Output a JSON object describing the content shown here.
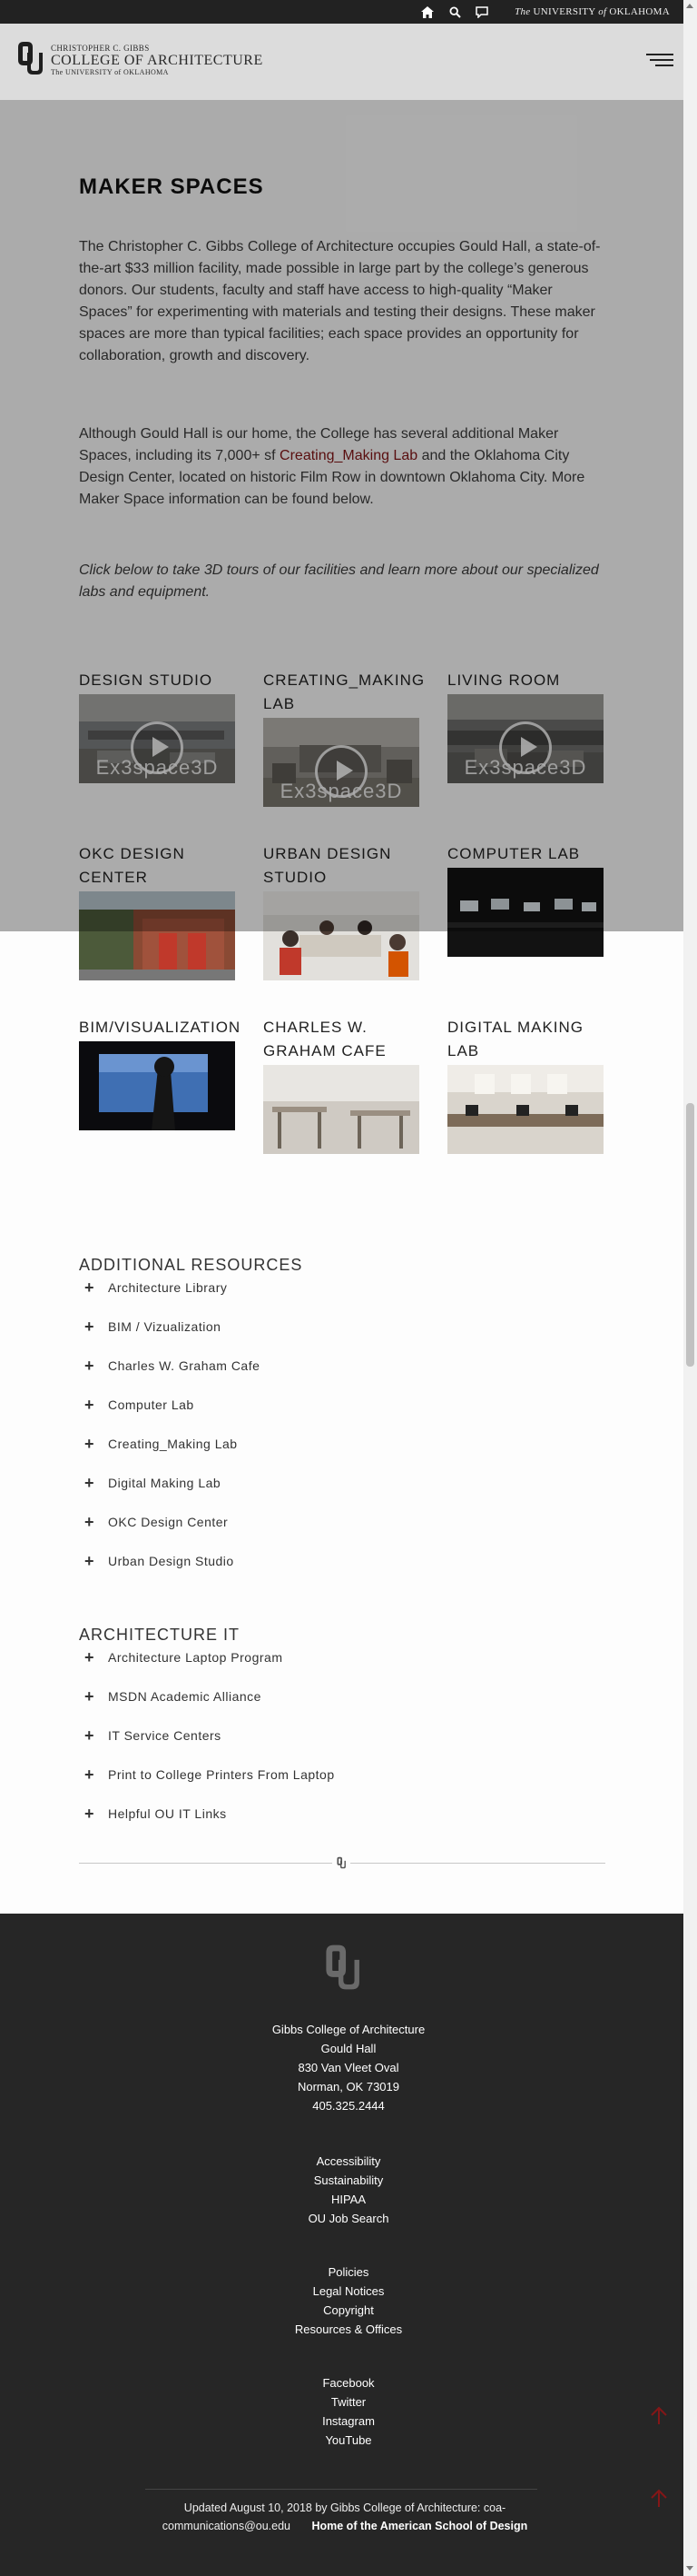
{
  "topbar": {
    "ou_the": "The",
    "ou_name": "UNIVERSITY",
    "ou_of": "of",
    "ou_state": "OKLAHOMA",
    "icons": [
      "home-icon",
      "search-icon",
      "chat-icon"
    ]
  },
  "header": {
    "logo_line1": "CHRISTOPHER C. GIBBS",
    "logo_line2": "COLLEGE OF ARCHITECTURE",
    "logo_line3": "The UNIVERSITY of OKLAHOMA"
  },
  "main": {
    "title": "MAKER SPACES",
    "p1": "The Christopher C. Gibbs College of Architecture occupies Gould Hall, a state-of-the-art $33 million facility, made possible in large part by the college’s generous donors. Our students, faculty and staff have access to high-quality “Maker Spaces” for experimenting with materials and testing their designs. These maker spaces are more than typical facilities; each space provides an opportunity for collaboration, growth and discovery.",
    "p2_before": "Although Gould Hall is our home, the College has several additional Maker Spaces, including its 7,000+ sf ",
    "p2_link": "Creating_Making Lab",
    "p2_after": " and the Oklahoma City Design Center, located on historic Film Row in downtown Oklahoma City. More Maker Space information can be found below.",
    "p3": "Click below to take 3D tours of our facilities and learn more about our specialized labs and equipment.",
    "tour_brand": "Ex3space3D",
    "tiles": [
      {
        "title": "DESIGN STUDIO"
      },
      {
        "title": "CREATING_MAKING LAB"
      },
      {
        "title": "LIVING ROOM"
      },
      {
        "title": "OKC DESIGN CENTER"
      },
      {
        "title": "URBAN DESIGN STUDIO"
      },
      {
        "title": "COMPUTER LAB"
      },
      {
        "title": "BIM/VISUALIZATION"
      },
      {
        "title": "CHARLES W. GRAHAM CAFE"
      },
      {
        "title": "DIGITAL MAKING LAB"
      }
    ]
  },
  "resources": {
    "heading": "ADDITIONAL RESOURCES",
    "items": [
      "Architecture Library",
      "BIM / Vizualization",
      "Charles W. Graham Cafe",
      "Computer Lab",
      "Creating_Making Lab",
      "Digital Making Lab",
      "OKC Design Center",
      "Urban Design Studio"
    ]
  },
  "it": {
    "heading": "ARCHITECTURE IT",
    "items": [
      "Architecture Laptop Program",
      "MSDN Academic Alliance",
      "IT Service Centers",
      "Print to College Printers From Laptop",
      "Helpful OU IT Links"
    ]
  },
  "footer": {
    "address": [
      "Gibbs College of Architecture",
      "Gould Hall",
      "830 Van Vleet Oval",
      "Norman, OK 73019",
      "405.325.2444"
    ],
    "links1": [
      "Accessibility",
      "Sustainability",
      "HIPAA",
      "OU Job Search"
    ],
    "links2": [
      "Policies",
      "Legal Notices",
      "Copyright",
      "Resources & Offices"
    ],
    "social": [
      "Facebook",
      "Twitter",
      "Instagram",
      "YouTube"
    ],
    "updated": "Updated August 10, 2018 by Gibbs College of Architecture: coa-communications@ou.edu",
    "tagline": "Home of the American School of Design"
  },
  "colors": {
    "crimson": "#841617",
    "footer_bg": "#262626",
    "topbar_bg": "#222222"
  }
}
